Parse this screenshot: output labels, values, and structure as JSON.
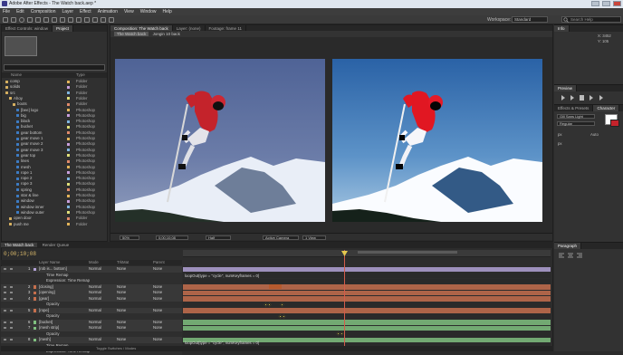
{
  "app": {
    "title": "Adobe After Effects - The Watch back.aep *"
  },
  "menu": [
    "File",
    "Edit",
    "Composition",
    "Layer",
    "Effect",
    "Animation",
    "View",
    "Window",
    "Help"
  ],
  "workspace": {
    "label": "Workspace:",
    "value": "Standard"
  },
  "search": {
    "placeholder": "Search Help"
  },
  "project_panel": {
    "tabs": [
      "Effect Controls: window",
      "Project"
    ],
    "columns": {
      "name": "Name",
      "type": "Type"
    },
    "items": [
      {
        "name": "comp",
        "type": "Folder",
        "indent": 0,
        "kind": "folder"
      },
      {
        "name": "solids",
        "type": "Folder",
        "indent": 0,
        "kind": "folder"
      },
      {
        "name": "src",
        "type": "Folder",
        "indent": 0,
        "kind": "folder"
      },
      {
        "name": "Ahoy",
        "type": "Folder",
        "indent": 1,
        "kind": "folder"
      },
      {
        "name": "boots",
        "type": "Folder",
        "indent": 2,
        "kind": "folder"
      },
      {
        "name": "[bee] logo",
        "type": "Photoshop",
        "indent": 3,
        "kind": "psd"
      },
      {
        "name": "big",
        "type": "Photoshop",
        "indent": 3,
        "kind": "psd"
      },
      {
        "name": "black",
        "type": "Photoshop",
        "indent": 3,
        "kind": "psd"
      },
      {
        "name": "bucket",
        "type": "Photoshop",
        "indent": 3,
        "kind": "psd"
      },
      {
        "name": "gear bottom",
        "type": "Photoshop",
        "indent": 3,
        "kind": "psd"
      },
      {
        "name": "gear move 1",
        "type": "Photoshop",
        "indent": 3,
        "kind": "psd"
      },
      {
        "name": "gear move 2",
        "type": "Photoshop",
        "indent": 3,
        "kind": "psd"
      },
      {
        "name": "gear move 3",
        "type": "Photoshop",
        "indent": 3,
        "kind": "psd"
      },
      {
        "name": "gear top",
        "type": "Photoshop",
        "indent": 3,
        "kind": "psd"
      },
      {
        "name": "lines",
        "type": "Photoshop",
        "indent": 3,
        "kind": "psd"
      },
      {
        "name": "mesh",
        "type": "Photoshop",
        "indent": 3,
        "kind": "psd"
      },
      {
        "name": "rope 1",
        "type": "Photoshop",
        "indent": 3,
        "kind": "psd"
      },
      {
        "name": "rope 2",
        "type": "Photoshop",
        "indent": 3,
        "kind": "psd"
      },
      {
        "name": "rope 3",
        "type": "Photoshop",
        "indent": 3,
        "kind": "psd"
      },
      {
        "name": "spring",
        "type": "Photoshop",
        "indent": 3,
        "kind": "psd"
      },
      {
        "name": "star & line",
        "type": "Photoshop",
        "indent": 3,
        "kind": "psd"
      },
      {
        "name": "window",
        "type": "Photoshop",
        "indent": 3,
        "kind": "psd"
      },
      {
        "name": "window inner",
        "type": "Photoshop",
        "indent": 3,
        "kind": "psd"
      },
      {
        "name": "window outer",
        "type": "Photoshop",
        "indent": 3,
        "kind": "psd"
      },
      {
        "name": "open door",
        "type": "Folder",
        "indent": 1,
        "kind": "folder"
      },
      {
        "name": "push me",
        "type": "Folder",
        "indent": 1,
        "kind": "folder"
      }
    ]
  },
  "comp_panel": {
    "tabs": [
      "Composition: The Watch back",
      "Layer: (none)",
      "Footage: frame 11"
    ],
    "subtabs": [
      "The Watch back",
      "Jongin 10 back"
    ],
    "controls": {
      "zoom": "50%",
      "timecode": "0;00;10;08",
      "resolution": "Half",
      "camera": "Active Camera",
      "views": "1 View"
    }
  },
  "right_panels": {
    "info": {
      "tab": "Info",
      "coords": [
        "X: 3452",
        "Y: 105"
      ]
    },
    "preview": {
      "tab": "Preview"
    },
    "effects": {
      "tabs": [
        "Effects & Presets",
        "Character"
      ],
      "font": "Gill Sans Light",
      "style": "Regular",
      "size": "px",
      "leading": "Auto",
      "tracking": "px"
    },
    "paragraph": {
      "tab": "Paragraph"
    }
  },
  "timeline": {
    "tabs": [
      "The Watch back",
      "Render Queue"
    ],
    "timecode": "0;00;10;08",
    "columns": {
      "name": "Layer Name",
      "mode": "Mode",
      "trkmat": "TrkMat",
      "parent": "Parent"
    },
    "layers": [
      {
        "num": "1",
        "name": "[rob is... bottom]",
        "mode": "Normal",
        "parent": "None",
        "color": "#b2a2d6",
        "sub": false
      },
      {
        "num": "",
        "name": "Time Remap",
        "mode": "",
        "parent": "",
        "color": "",
        "sub": true
      },
      {
        "num": "",
        "name": "Expression: Time Remap",
        "mode": "",
        "parent": "",
        "color": "",
        "sub": true
      },
      {
        "num": "2",
        "name": "[closing]",
        "mode": "Normal",
        "parent": "None",
        "color": "#c66f4d",
        "sub": false
      },
      {
        "num": "3",
        "name": "[opening]",
        "mode": "Normal",
        "parent": "None",
        "color": "#c66f4d",
        "sub": false
      },
      {
        "num": "4",
        "name": "[gear]",
        "mode": "Normal",
        "parent": "None",
        "color": "#c66f4d",
        "sub": false
      },
      {
        "num": "",
        "name": "Opacity",
        "mode": "",
        "parent": "",
        "color": "",
        "sub": true
      },
      {
        "num": "5",
        "name": "[rope]",
        "mode": "Normal",
        "parent": "None",
        "color": "#c66f4d",
        "sub": false
      },
      {
        "num": "",
        "name": "Opacity",
        "mode": "",
        "parent": "",
        "color": "",
        "sub": true
      },
      {
        "num": "6",
        "name": "[bucket]",
        "mode": "Normal",
        "parent": "None",
        "color": "#7fbf7f",
        "sub": false
      },
      {
        "num": "7",
        "name": "[mesh strip]",
        "mode": "Normal",
        "parent": "None",
        "color": "#7fbf7f",
        "sub": false
      },
      {
        "num": "",
        "name": "Opacity",
        "mode": "",
        "parent": "",
        "color": "",
        "sub": true
      },
      {
        "num": "8",
        "name": "[mesh]",
        "mode": "Normal",
        "parent": "None",
        "color": "#7fbf7f",
        "sub": false
      },
      {
        "num": "",
        "name": "Time Remap",
        "mode": "",
        "parent": "",
        "color": "",
        "sub": true
      },
      {
        "num": "",
        "name": "Expression: Time Remap",
        "mode": "",
        "parent": "",
        "color": "",
        "sub": true
      }
    ],
    "expressions": [
      "loopOut(type = \"cycle\", numKeyframes = 0)",
      "loopOut(type = \"cycle\", numKeyframes = 0)"
    ],
    "footer": "Toggle Switches / Modes"
  }
}
